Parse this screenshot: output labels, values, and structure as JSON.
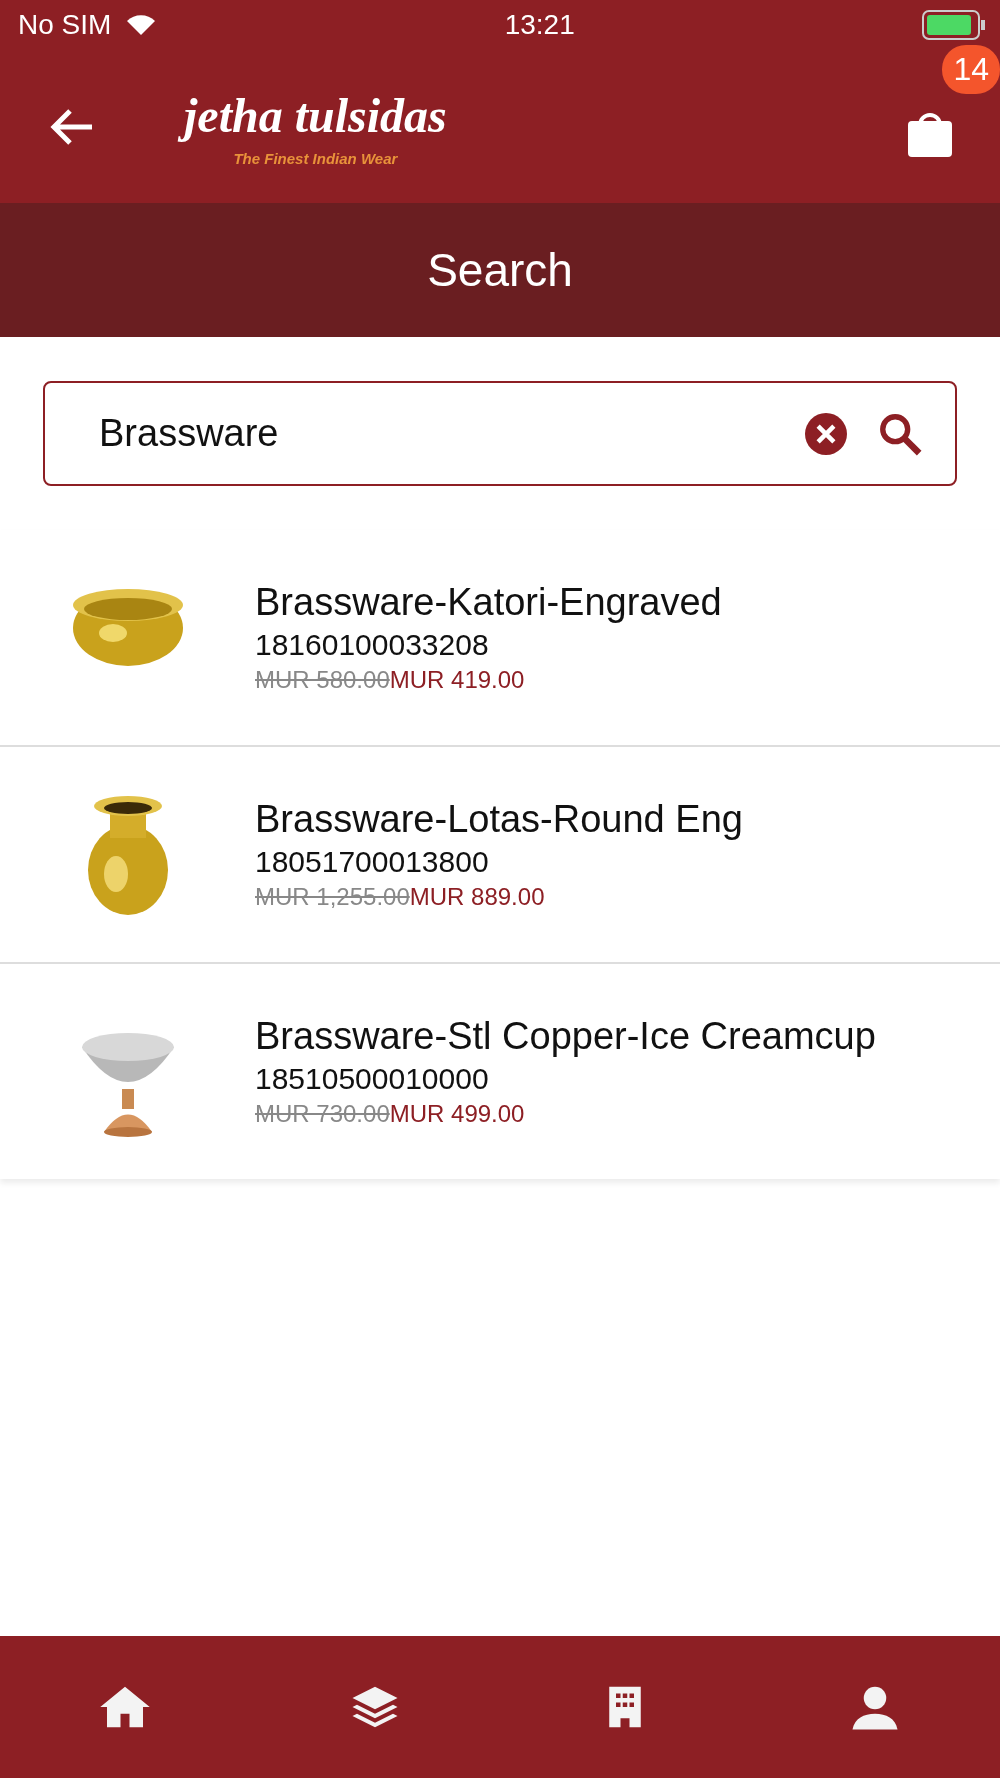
{
  "status_bar": {
    "carrier": "No SIM",
    "time": "13:21"
  },
  "header": {
    "logo": "jetha tulsidas",
    "tagline": "The Finest Indian Wear",
    "cart_count": "14"
  },
  "title": "Search",
  "search": {
    "value": "Brassware"
  },
  "products": [
    {
      "name": "Brassware-Katori-Engraved",
      "code": "18160100033208",
      "old_price": "MUR 580.00",
      "price": "MUR 419.00"
    },
    {
      "name": "Brassware-Lotas-Round Eng",
      "code": "18051700013800",
      "old_price": "MUR 1,255.00",
      "price": "MUR 889.00"
    },
    {
      "name": "Brassware-Stl Copper-Ice Creamcup",
      "code": "18510500010000",
      "old_price": "MUR 730.00",
      "price": "MUR 499.00"
    }
  ],
  "tab_bar": [
    {
      "kind": "home",
      "selected": false
    },
    {
      "kind": "layers",
      "selected": false
    },
    {
      "kind": "building",
      "selected": false
    },
    {
      "kind": "user",
      "selected": false
    }
  ]
}
